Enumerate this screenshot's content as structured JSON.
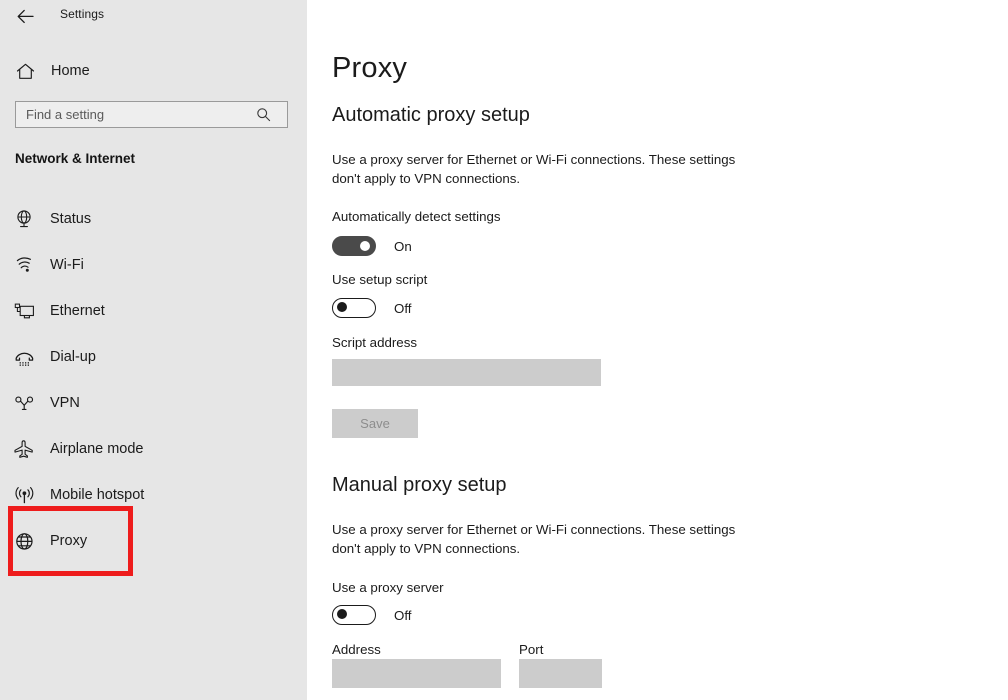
{
  "window": {
    "title": "Settings",
    "back_icon": "back-arrow-icon"
  },
  "sidebar": {
    "home": {
      "label": "Home",
      "icon": "home-icon"
    },
    "search": {
      "value": "",
      "placeholder": "Find a setting",
      "icon": "search-icon"
    },
    "group_title": "Network & Internet",
    "items": [
      {
        "label": "Status",
        "icon": "globe-status-icon",
        "selected": false
      },
      {
        "label": "Wi-Fi",
        "icon": "wifi-icon",
        "selected": false
      },
      {
        "label": "Ethernet",
        "icon": "monitor-ethernet-icon",
        "selected": false
      },
      {
        "label": "Dial-up",
        "icon": "phone-handset-icon",
        "selected": false
      },
      {
        "label": "VPN",
        "icon": "vpn-icon",
        "selected": false
      },
      {
        "label": "Airplane mode",
        "icon": "airplane-icon",
        "selected": false
      },
      {
        "label": "Mobile hotspot",
        "icon": "broadcast-antenna-icon",
        "selected": false
      },
      {
        "label": "Proxy",
        "icon": "globe-proxy-icon",
        "selected": true
      }
    ],
    "annotation_color": "#ee1c1c"
  },
  "main": {
    "page_title": "Proxy",
    "automatic": {
      "heading": "Automatic proxy setup",
      "description": "Use a proxy server for Ethernet or Wi-Fi connections. These settings don't apply to VPN connections.",
      "auto_detect": {
        "label": "Automatically detect settings",
        "state": "On"
      },
      "setup_script": {
        "label": "Use setup script",
        "state": "Off"
      },
      "script_address": {
        "label": "Script address",
        "value": ""
      },
      "save_label": "Save"
    },
    "manual": {
      "heading": "Manual proxy setup",
      "description": "Use a proxy server for Ethernet or Wi-Fi connections. These settings don't apply to VPN connections.",
      "use_proxy": {
        "label": "Use a proxy server",
        "state": "Off"
      },
      "address": {
        "label": "Address",
        "value": ""
      },
      "port": {
        "label": "Port",
        "value": ""
      }
    }
  }
}
